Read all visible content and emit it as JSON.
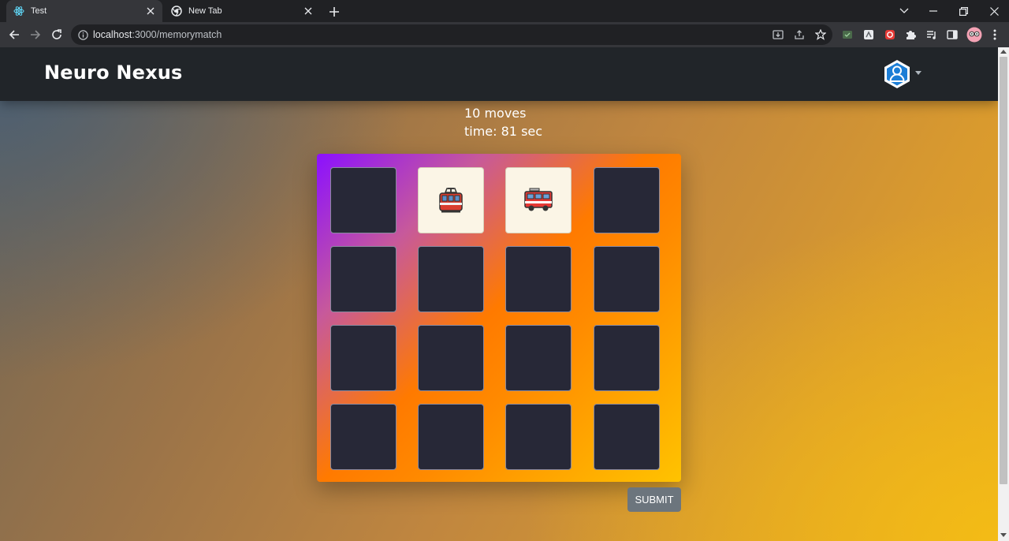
{
  "browser": {
    "tabs": [
      {
        "title": "Test",
        "icon": "react-icon",
        "active": true
      },
      {
        "title": "New Tab",
        "icon": "chrome-icon",
        "active": false
      }
    ],
    "url_host": "localhost",
    "url_path": ":3000/memorymatch"
  },
  "app": {
    "brand": "Neuro Nexus",
    "profile_icon": "user-hexagon-icon"
  },
  "game": {
    "moves": "10 moves",
    "time": "time: 81 sec",
    "cards": [
      {
        "state": "hidden"
      },
      {
        "state": "flipped",
        "emoji": "🚋",
        "icon": "tram-icon"
      },
      {
        "state": "flipped",
        "emoji": "🚒",
        "icon": "fire-engine-icon"
      },
      {
        "state": "hidden"
      },
      {
        "state": "hidden"
      },
      {
        "state": "hidden"
      },
      {
        "state": "hidden"
      },
      {
        "state": "hidden"
      },
      {
        "state": "hidden"
      },
      {
        "state": "hidden"
      },
      {
        "state": "hidden"
      },
      {
        "state": "hidden"
      },
      {
        "state": "hidden"
      },
      {
        "state": "hidden"
      },
      {
        "state": "hidden"
      },
      {
        "state": "hidden"
      }
    ],
    "submit_label": "SUBMIT"
  },
  "colors": {
    "navbar": "#212529",
    "card_back": "#272837",
    "card_face": "#fbf5e6",
    "submit": "#6c757d"
  }
}
